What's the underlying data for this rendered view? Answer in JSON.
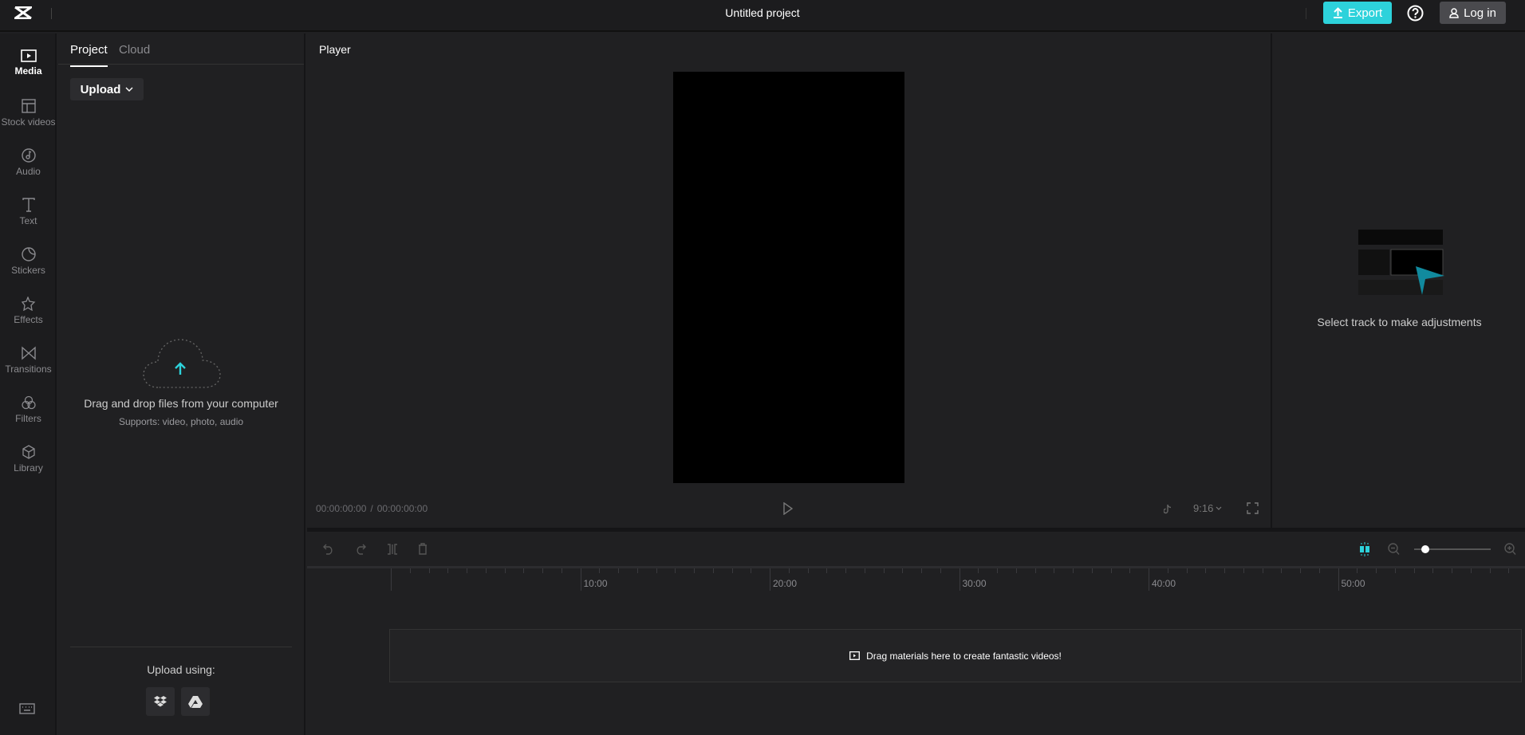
{
  "header": {
    "title": "Untitled project",
    "export_label": "Export",
    "login_label": "Log in",
    "accent": "#2dd2db"
  },
  "rail": {
    "items": [
      {
        "label": "Media",
        "icon": "media-icon",
        "active": true
      },
      {
        "label": "Stock videos",
        "icon": "stock-videos-icon"
      },
      {
        "label": "Audio",
        "icon": "audio-icon"
      },
      {
        "label": "Text",
        "icon": "text-icon"
      },
      {
        "label": "Stickers",
        "icon": "stickers-icon"
      },
      {
        "label": "Effects",
        "icon": "effects-icon"
      },
      {
        "label": "Transitions",
        "icon": "transitions-icon"
      },
      {
        "label": "Filters",
        "icon": "filters-icon"
      },
      {
        "label": "Library",
        "icon": "library-icon"
      }
    ]
  },
  "media": {
    "tabs": [
      {
        "label": "Project",
        "active": true
      },
      {
        "label": "Cloud"
      }
    ],
    "upload_label": "Upload",
    "drop_title": "Drag and drop files from your computer",
    "drop_sub": "Supports: video, photo, audio",
    "upload_using": "Upload using:"
  },
  "player": {
    "title": "Player",
    "current_time": "00:00:00:00",
    "separator": "/",
    "total_time": "00:00:00:00",
    "ratio": "9:16"
  },
  "inspector": {
    "message": "Select track to make adjustments"
  },
  "timeline": {
    "ruler": [
      "10:00",
      "20:00",
      "30:00",
      "40:00",
      "50:00"
    ],
    "drop_hint": "Drag materials here to create fantastic videos!",
    "zoom_level": 0.15
  }
}
